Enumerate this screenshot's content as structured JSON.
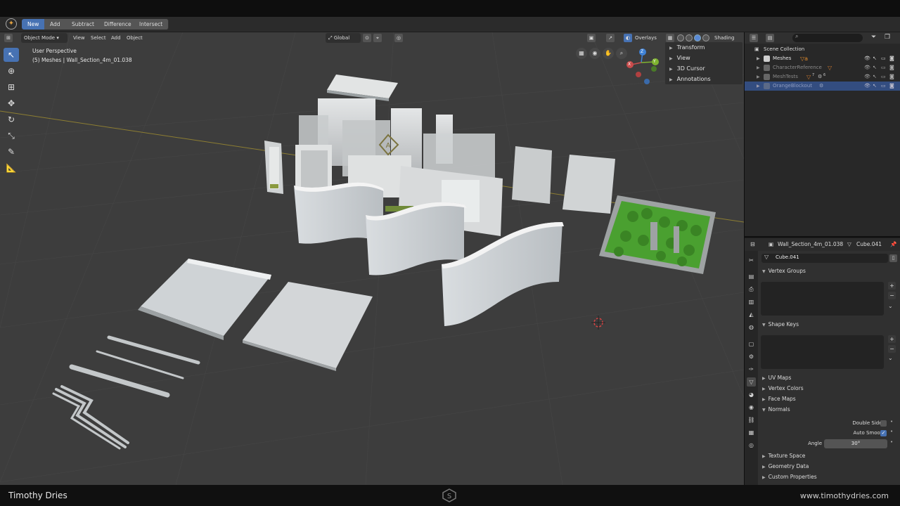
{
  "toolbar": {
    "items": [
      "New",
      "Add",
      "Subtract",
      "Difference",
      "Intersect"
    ]
  },
  "viewport_header": {
    "mode": "Object Mode",
    "menus": [
      "View",
      "Select",
      "Add",
      "Object"
    ],
    "orientation": "Global",
    "overlays_label": "Overlays",
    "shading_label": "Shading"
  },
  "viewport": {
    "perspective": "User Perspective",
    "selection_info": "(5) Meshes | Wall_Section_4m_01.038",
    "gizmo_axes": [
      "Z",
      "Y",
      "X"
    ],
    "npanel": [
      "Transform",
      "View",
      "3D Cursor",
      "Annotations"
    ]
  },
  "outliner": {
    "search_placeholder": "",
    "root": "Scene Collection",
    "collections": [
      {
        "name": "Meshes",
        "selected": false,
        "dim": false
      },
      {
        "name": "CharacterReference",
        "selected": false,
        "dim": true
      },
      {
        "name": "MeshTests",
        "selected": false,
        "dim": true
      },
      {
        "name": "OrangeBlockout",
        "selected": true,
        "dim": true
      }
    ],
    "badges": [
      "7",
      "6"
    ]
  },
  "properties": {
    "object_name": "Wall_Section_4m_01.038",
    "mesh_name": "Cube.041",
    "data_field": "Cube.041",
    "sections": {
      "vertex_groups": "Vertex Groups",
      "shape_keys": "Shape Keys",
      "uv_maps": "UV Maps",
      "vertex_colors": "Vertex Colors",
      "face_maps": "Face Maps",
      "normals": "Normals",
      "texture_space": "Texture Space",
      "geometry_data": "Geometry Data",
      "custom_properties": "Custom Properties"
    },
    "normals": {
      "double_sided_label": "Double Sided",
      "double_sided": false,
      "auto_smooth_label": "Auto Smooth",
      "auto_smooth": true,
      "angle_label": "Angle",
      "angle_value": "30°"
    }
  },
  "footer": {
    "author": "Timothy Dries",
    "website": "www.timothydries.com"
  },
  "colors": {
    "accent": "#4772b3",
    "viewport_bg": "#3d3d3d",
    "axis_x": "#c94c4c",
    "axis_y": "#7fb430",
    "axis_z": "#3f82d6",
    "foliage": "#4aa030"
  }
}
